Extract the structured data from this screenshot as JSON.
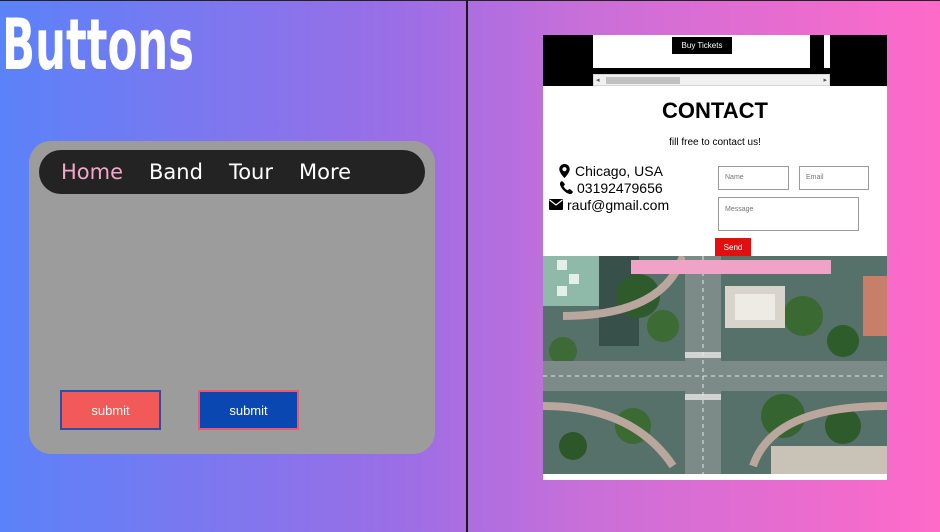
{
  "left_panel": {
    "heading": "Buttons",
    "nav": {
      "items": [
        "Home",
        "Band",
        "Tour",
        "More"
      ],
      "active_color": "#f4a6c8"
    },
    "buttons": [
      {
        "label": "submit",
        "bg": "#f25a5a",
        "border": "#2f4fa6"
      },
      {
        "label": "submit",
        "bg": "#0b47b1",
        "border": "#ea5a6e"
      }
    ]
  },
  "preview": {
    "buy_tickets": "Buy Tickets",
    "contact_title": "CONTACT",
    "subtitle": "fill free to contact us!",
    "info": {
      "location": "Chicago, USA",
      "phone": "03192479656",
      "email": "rauf@gmail.com"
    },
    "icons": [
      "map-marker-icon",
      "phone-icon",
      "envelope-icon"
    ],
    "form": {
      "name_placeholder": "Name",
      "email_placeholder": "Email",
      "message_placeholder": "Message",
      "send_label": "Send"
    },
    "send_color": "#e01010"
  }
}
